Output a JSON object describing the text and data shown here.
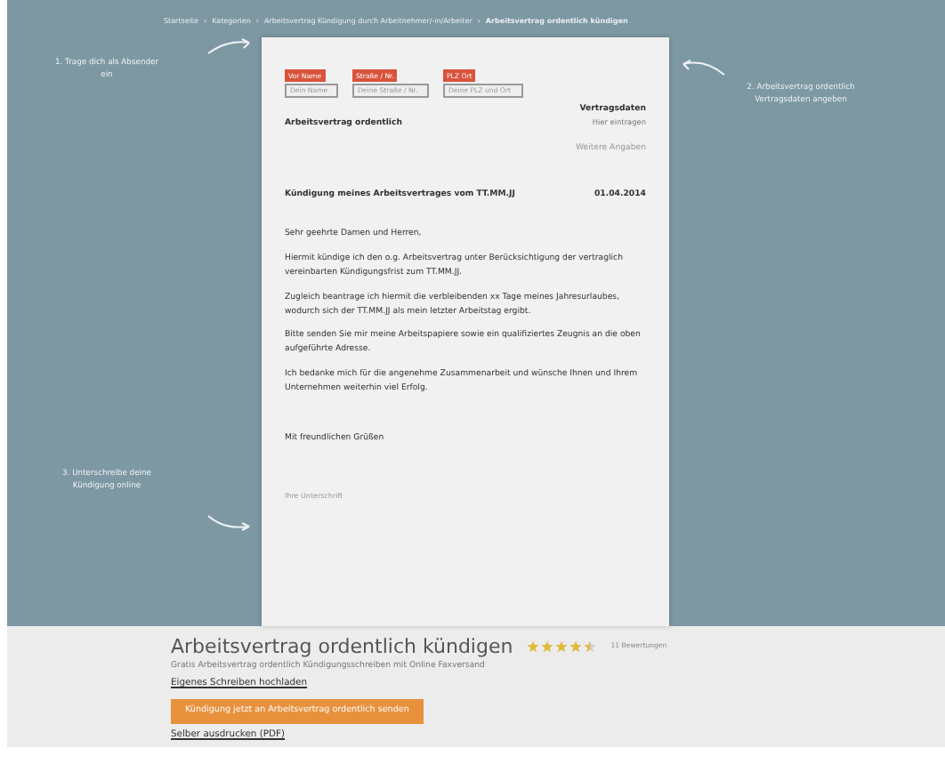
{
  "breadcrumb": [
    {
      "label": "Startseite",
      "current": false
    },
    {
      "separator": "›",
      "label": "Kategorien",
      "current": false
    },
    {
      "separator": "›",
      "label": "Arbeitsvertrag Kündigung durch Arbeitnehmer/-in/Arbeiter",
      "current": false
    },
    {
      "separator": "›",
      "label": "Arbeitsvertrag ordentlich kündigen",
      "current": true
    }
  ],
  "steps": [
    {
      "text": "1. Trage dich als Absender ein"
    },
    {
      "text": "2. Arbeitsvertrag ordentlich Vertragsdaten angeben"
    },
    {
      "text": "3. Unterschreibe deine Kündigung online"
    }
  ],
  "letter": {
    "sender_fields": [
      {
        "tag": "Vor Name",
        "placeholder": "Dein Name"
      },
      {
        "tag": "Straße / Nr.",
        "placeholder": "Deine Straße / Nr."
      },
      {
        "tag": "PLZ Ort",
        "placeholder": "Deine PLZ und Ort"
      }
    ],
    "recipient": "Arbeitsvertrag ordentlich",
    "contract_heading": "Vertragsdaten",
    "contract_placeholder": "Hier eintragen",
    "more_info": "Weitere Angaben",
    "subject": "Kündigung meines Arbeitsvertrages vom TT.MM.JJ",
    "date": "01.04.2014",
    "salutation": "Sehr geehrte Damen und Herren,",
    "paragraphs": [
      "Hiermit kündige ich den o.g. Arbeitsvertrag unter Berücksichtigung der vertraglich vereinbarten Kündigungsfrist zum TT.MM.JJ.",
      "Zugleich beantrage ich hiermit die verbleibenden xx Tage meines Jahresurlaubes, wodurch sich der TT.MM.JJ als mein letzter Arbeitstag ergibt.",
      "Bitte senden Sie mir meine Arbeitspapiere sowie ein qualifiziertes Zeugnis an die oben aufgeführte Adresse.",
      "Ich bedanke mich für die angenehme Zusammenarbeit und wünsche Ihnen und Ihrem Unternehmen weiterhin viel Erfolg."
    ],
    "closing": "Mit freundlichen Grüßen",
    "signature_placeholder": "Ihre Unterschrift"
  },
  "product": {
    "title": "Arbeitsvertrag ordentlich kündigen",
    "stars": 4.5,
    "reviews": "11 Bewertungen",
    "subtitle": "Gratis Arbeitsvertrag ordentlich Kündigungsschreiben mit Online Faxversand",
    "upload_link": "Eigenes Schreiben hochladen",
    "send_button": "Kündigung jetzt an Arbeitsvertrag ordentlich senden",
    "print_link": "Selber ausdrucken (PDF)"
  }
}
